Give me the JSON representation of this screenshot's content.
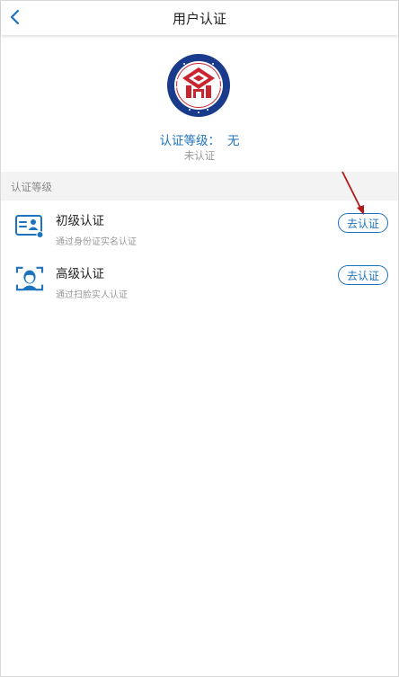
{
  "header": {
    "title": "用户认证"
  },
  "profile": {
    "level_label": "认证等级：",
    "level_value": "无",
    "status": "未认证"
  },
  "section_title": "认证等级",
  "items": [
    {
      "title": "初级认证",
      "desc": "通过身份证实名认证",
      "button": "去认证",
      "icon": "id-card-icon"
    },
    {
      "title": "高级认证",
      "desc": "通过扫脸实人认证",
      "button": "去认证",
      "icon": "face-scan-icon"
    }
  ],
  "colors": {
    "accent": "#1e73be",
    "logo_navy": "#1a3a8c",
    "logo_red": "#c9252f",
    "arrow": "#b31b1b"
  }
}
